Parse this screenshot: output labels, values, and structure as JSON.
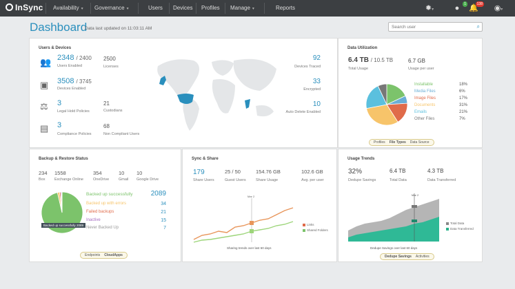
{
  "nav": {
    "brand": "InSync",
    "items": [
      {
        "label": "Availability",
        "caret": "▾"
      },
      {
        "label": "Governance",
        "caret": "▾"
      },
      {
        "label": "Users"
      },
      {
        "label": "Devices"
      },
      {
        "label": "Profiles"
      },
      {
        "label": "Manage",
        "caret": "▾"
      },
      {
        "label": "Reports"
      }
    ],
    "badge_green": "1",
    "badge_red": "138"
  },
  "header": {
    "title": "Dashboard",
    "updated": "Data last updated on 11:03:11 AM",
    "search_placeholder": "Search user"
  },
  "users_devices": {
    "title": "Users & Devices",
    "stats": [
      {
        "value": "2348",
        "total": "/ 2400",
        "label": "Users Enabled",
        "icon": "users-icon"
      },
      {
        "value": "3508",
        "total": "/ 3745",
        "label": "Devices Enabled",
        "icon": "devices-icon"
      },
      {
        "value": "3",
        "label": "Legal Hold Policies",
        "icon": "gavel-icon"
      },
      {
        "value": "3",
        "label": "Compliance Policies",
        "icon": "policy-icon"
      }
    ],
    "mid": [
      {
        "value": "2500",
        "label": "Licenses"
      },
      {
        "value": "21",
        "label": "Custodians"
      },
      {
        "value": "68",
        "label": "Non Compliant Users"
      }
    ],
    "right": [
      {
        "value": "92",
        "label": "Devices Traced"
      },
      {
        "value": "33",
        "label": "Encrypted"
      },
      {
        "value": "10",
        "label": "Auto Delete Enabled"
      }
    ]
  },
  "data_utilization": {
    "title": "Data Utilization",
    "total_value": "6.4 TB",
    "total_denominator": "/ 10.5 TB",
    "total_label": "Total Usage",
    "per_user_value": "6.7 GB",
    "per_user_label": "Usage per user",
    "legend": [
      {
        "label": "Installable",
        "pct": "18%",
        "color": "#7cc36b",
        "value": 18
      },
      {
        "label": "Media Files",
        "pct": "6%",
        "color": "#6aaed6",
        "value": 6
      },
      {
        "label": "Image Files",
        "pct": "17%",
        "color": "#e06b4a",
        "value": 17
      },
      {
        "label": "Documents",
        "pct": "31%",
        "color": "#f7c46a",
        "value": 31
      },
      {
        "label": "Emails",
        "pct": "21%",
        "color": "#5bc0de",
        "value": 21
      },
      {
        "label": "Other Files",
        "pct": "7%",
        "color": "#777777",
        "value": 7
      }
    ],
    "tabs": [
      "Profiles",
      "File Types",
      "Data Source"
    ]
  },
  "backup": {
    "title": "Backup & Restore Status",
    "stats": [
      {
        "value": "234",
        "label": "Box"
      },
      {
        "value": "1558",
        "label": "Exchange Online"
      },
      {
        "value": "354",
        "label": "OneDrive"
      },
      {
        "value": "10",
        "label": "Gmail"
      },
      {
        "value": "10",
        "label": "Google Drive"
      }
    ],
    "legend": [
      {
        "label": "Backed up successfully",
        "value": "2089",
        "color": "#7cc36b"
      },
      {
        "label": "Backed up with errors",
        "value": "34",
        "color": "#f7c46a"
      },
      {
        "label": "Failed backups",
        "value": "21",
        "color": "#e06b4a"
      },
      {
        "label": "Inactive",
        "value": "15",
        "color": "#a66dc2"
      },
      {
        "label": "Never Backed Up",
        "value": "7",
        "color": "#999999"
      }
    ],
    "tooltip": "Backed up successfully 2089",
    "tabs": [
      "Endpoints",
      "CloudApps"
    ]
  },
  "sync": {
    "title": "Sync & Share",
    "stats": [
      {
        "value": "179",
        "label": "Share Users"
      },
      {
        "value": "25 / 50",
        "label": "Guest Users"
      },
      {
        "value": "154.76 GB",
        "label": "Share Usage"
      },
      {
        "value": "102.6 GB",
        "label": "Avg. per user"
      }
    ],
    "marker": "Mar 2",
    "legend": [
      {
        "label": "Links",
        "color": "#e06b4a"
      },
      {
        "label": "Shared Folders",
        "color": "#7cc36b"
      }
    ],
    "caption": "Sharing trends over last 60 days"
  },
  "trends": {
    "title": "Usage Trends",
    "stats": [
      {
        "value": "32%",
        "label": "Dedupe Savings"
      },
      {
        "value": "6.4 TB",
        "label": "Total Data"
      },
      {
        "value": "4.3 TB",
        "label": "Data Transferred"
      }
    ],
    "marker": "Mar 2",
    "legend": [
      {
        "label": "Total Data",
        "color": "#888888"
      },
      {
        "label": "Data Transferred",
        "color": "#29b28a"
      }
    ],
    "caption": "Dedupe Savings over last 60 days",
    "tabs": [
      "Dedupe Savings",
      "Activities"
    ]
  }
}
